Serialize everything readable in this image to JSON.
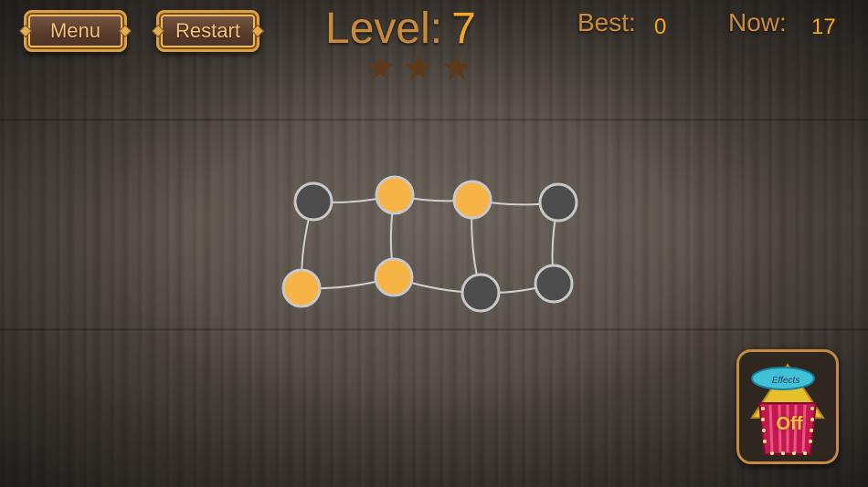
{
  "toolbar": {
    "menu_label": "Menu",
    "restart_label": "Restart"
  },
  "level": {
    "label": "Level:",
    "number": "7",
    "stars": 3
  },
  "score": {
    "best_label": "Best:",
    "best_value": "0",
    "now_label": "Now:",
    "now_value": "17"
  },
  "board": {
    "nodes": [
      {
        "id": "n1",
        "state": "off"
      },
      {
        "id": "n2",
        "state": "on"
      },
      {
        "id": "n3",
        "state": "on"
      },
      {
        "id": "n4",
        "state": "off"
      },
      {
        "id": "n5",
        "state": "on"
      },
      {
        "id": "n6",
        "state": "on"
      },
      {
        "id": "n7",
        "state": "off"
      },
      {
        "id": "n8",
        "state": "off"
      }
    ],
    "edges": [
      [
        "n1",
        "n2"
      ],
      [
        "n2",
        "n3"
      ],
      [
        "n3",
        "n4"
      ],
      [
        "n1",
        "n5"
      ],
      [
        "n2",
        "n6"
      ],
      [
        "n5",
        "n6"
      ],
      [
        "n6",
        "n7"
      ],
      [
        "n3",
        "n7"
      ],
      [
        "n7",
        "n8"
      ],
      [
        "n4",
        "n8"
      ]
    ]
  },
  "effects": {
    "label": "Effects",
    "state": "Off"
  },
  "colors": {
    "node_on": "#f7b346",
    "node_off": "#4d4d4d",
    "node_ring": "#c8c8c8",
    "edge": "#cfcfcf",
    "star": "#5c3a1a",
    "accent": "#f5a623"
  }
}
